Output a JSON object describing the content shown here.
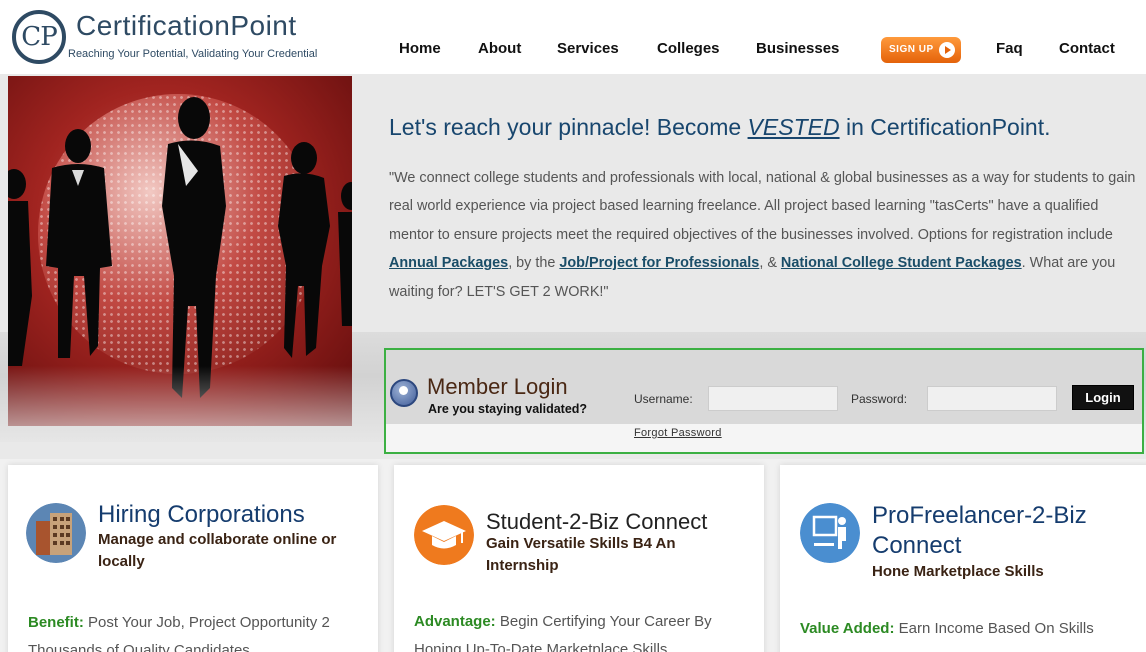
{
  "header": {
    "logo_mark": "CP",
    "logo_name": "CertificationPoint",
    "logo_tagline": "Reaching Your Potential, Validating Your Credential"
  },
  "nav": {
    "home": "Home",
    "about": "About",
    "services": "Services",
    "colleges": "Colleges",
    "businesses": "Businesses",
    "signup": "SIGN UP",
    "faq": "Faq",
    "contact": "Contact"
  },
  "hero": {
    "headline_pre": "Let's reach your pinnacle! Become ",
    "headline_em": "VESTED",
    "headline_post": " in CertificationPoint.",
    "text_1": "\"We connect college students and professionals with local, national & global businesses as a way for students to gain real world experience via project based learning freelance. All project based learning \"tasCerts\" have a qualified mentor to ensure projects meet the required objectives of the businesses involved. Options for registration include ",
    "link_annual": "Annual Packages",
    "text_2": ", by the ",
    "link_job": "Job/Project for Professionals",
    "text_3": ", & ",
    "link_national": "National College Student Packages",
    "text_4": ". What are you waiting for? LET'S GET 2 WORK!\""
  },
  "login": {
    "title": "Member Login",
    "subtitle": "Are you staying validated?",
    "username_label": "Username:",
    "username_value": "",
    "password_label": "Password:",
    "password_value": "",
    "button": "Login",
    "forgot": "Forgot Password"
  },
  "cards": [
    {
      "icon": "building-icon",
      "title": "Hiring Corporations",
      "subtitle": "Manage and collaborate online or locally",
      "lead": "Benefit:",
      "body": " Post Your Job, Project Opportunity 2 Thousands of Quality Candidates"
    },
    {
      "icon": "graduation-cap-icon",
      "title": "Student-2-Biz Connect",
      "subtitle": "Gain Versatile Skills B4 An Internship",
      "lead": "Advantage:",
      "body": " Begin Certifying Your Career By Honing Up-To-Date Marketplace Skills"
    },
    {
      "icon": "presenter-icon",
      "title": "ProFreelancer-2-Biz Connect",
      "subtitle": "Hone Marketplace Skills",
      "lead": "Value Added:",
      "body": " Earn Income Based On Skills"
    }
  ],
  "colors": {
    "brand_blue": "#2e4a63",
    "headline_blue": "#18466e",
    "login_border": "#3cb043",
    "signup_orange": "#f07a1e",
    "lead_green": "#2c8a23"
  }
}
